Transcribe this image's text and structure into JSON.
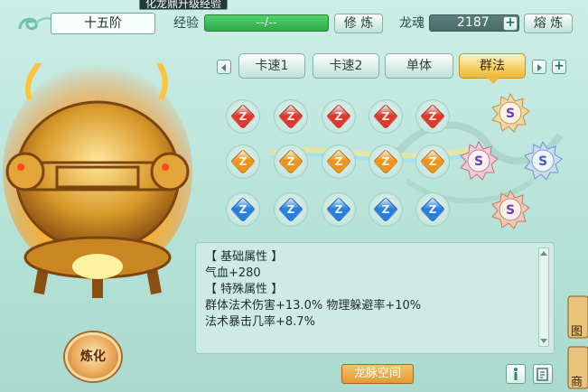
{
  "tooltip": "化龙鼎升级经验",
  "rank": "十五阶",
  "exp": {
    "label": "经验",
    "value": "--/--",
    "button": "修 炼"
  },
  "dragon_soul": {
    "label": "龙魂",
    "value": "2187",
    "button": "熔 炼"
  },
  "tabs": [
    {
      "label": "卡速1",
      "active": false
    },
    {
      "label": "卡速2",
      "active": false
    },
    {
      "label": "单体",
      "active": false
    },
    {
      "label": "群法",
      "active": true
    }
  ],
  "gem_rows": [
    {
      "color": "red",
      "hex": "#e0392b",
      "count": 5
    },
    {
      "color": "orange",
      "hex": "#f09418",
      "count": 5
    },
    {
      "color": "blue",
      "hex": "#2a7fe0",
      "count": 5
    }
  ],
  "attributes": {
    "base_header": "【 基础属性 】",
    "base_line": "气血+280",
    "special_header": "【 特殊属性 】",
    "special_line1": "群体法术伤害+13.0%  物理躲避率+10%",
    "special_line2": "法术暴击几率+8.7%"
  },
  "refine_button": "炼化",
  "meridian_button": "龙脉空间",
  "side_labels": {
    "top": "图",
    "bottom": "商"
  },
  "colors": {
    "accent": "#2ea84a",
    "active_tab": "#f6cf62",
    "panel": "#cfeae3"
  }
}
